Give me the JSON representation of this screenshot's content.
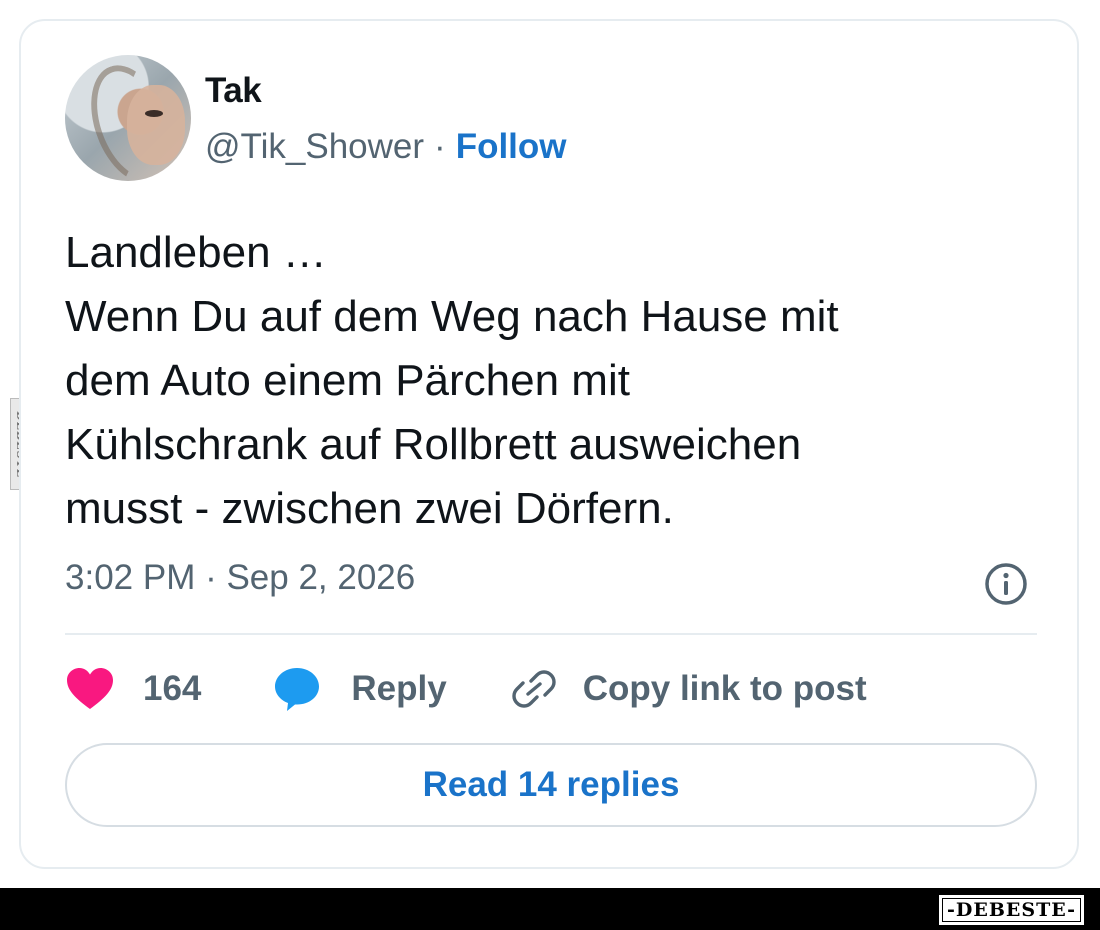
{
  "user": {
    "name": "Tak",
    "handle": "@Tik_Shower",
    "separator": "·",
    "follow_label": "Follow"
  },
  "tweet": {
    "text": "Landleben …\nWenn Du auf dem Weg nach Hause mit\ndem Auto einem Pärchen mit\nKühlschrank auf Rollbrett ausweichen\nmusst - zwischen zwei Dörfern.",
    "timestamp": "3:02 PM · Sep 2, 2026"
  },
  "actions": {
    "likes": "164",
    "reply_label": "Reply",
    "copy_label": "Copy link to post"
  },
  "read_replies_label": "Read 14 replies",
  "watermark": {
    "footer_logo": "-DEBESTE-",
    "side_text": "DEBESTE"
  },
  "colors": {
    "like": "#f91880",
    "reply": "#1d9bf0",
    "link": "#1a73c9",
    "muted": "#536471"
  },
  "icons": [
    "heart-icon",
    "speech-bubble-icon",
    "link-icon",
    "info-icon"
  ]
}
